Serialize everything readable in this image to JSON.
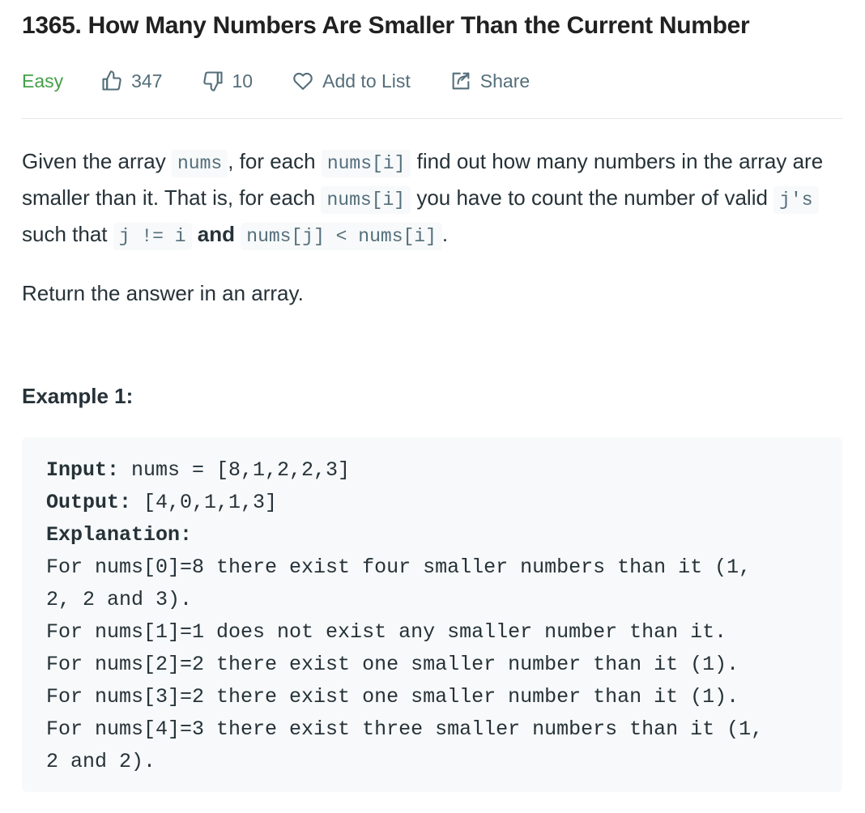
{
  "problem": {
    "title": "1365. How Many Numbers Are Smaller Than the Current Number",
    "difficulty": "Easy",
    "likes": "347",
    "dislikes": "10",
    "add_to_list_label": "Add to List",
    "share_label": "Share"
  },
  "description": {
    "p1": [
      {
        "t": "text",
        "v": "Given the array "
      },
      {
        "t": "code",
        "v": "nums"
      },
      {
        "t": "text",
        "v": ", for each "
      },
      {
        "t": "code",
        "v": "nums[i]"
      },
      {
        "t": "text",
        "v": " find out how many numbers in the array are smaller than it. That is, for each "
      },
      {
        "t": "code",
        "v": "nums[i]"
      },
      {
        "t": "text",
        "v": " you have to count the number of valid "
      },
      {
        "t": "code",
        "v": "j's"
      },
      {
        "t": "text",
        "v": " such that "
      },
      {
        "t": "code",
        "v": "j != i"
      },
      {
        "t": "text",
        "v": " "
      },
      {
        "t": "bold",
        "v": "and"
      },
      {
        "t": "text",
        "v": " "
      },
      {
        "t": "code",
        "v": "nums[j] < nums[i]"
      },
      {
        "t": "text",
        "v": "."
      }
    ],
    "p2": "Return the answer in an array."
  },
  "example": {
    "heading": "Example 1:",
    "input_label": "Input:",
    "input_value": " nums = [8,1,2,2,3]",
    "output_label": "Output:",
    "output_value": " [4,0,1,1,3]",
    "explanation_label": "Explanation:",
    "explanation_lines": [
      "For nums[0]=8 there exist four smaller numbers than it (1,",
      "2, 2 and 3).",
      "For nums[1]=1 does not exist any smaller number than it.",
      "For nums[2]=2 there exist one smaller number than it (1).",
      "For nums[3]=2 there exist one smaller number than it (1).",
      "For nums[4]=3 there exist three smaller numbers than it (1,",
      "2 and 2)."
    ]
  },
  "icons": {
    "like": "thumbs-up-icon",
    "dislike": "thumbs-down-icon",
    "add_to_list": "heart-icon",
    "share": "share-icon"
  },
  "colors": {
    "difficulty_easy": "#43a047",
    "meta_text": "#546e7a",
    "code_background": "#f7f9fa"
  }
}
